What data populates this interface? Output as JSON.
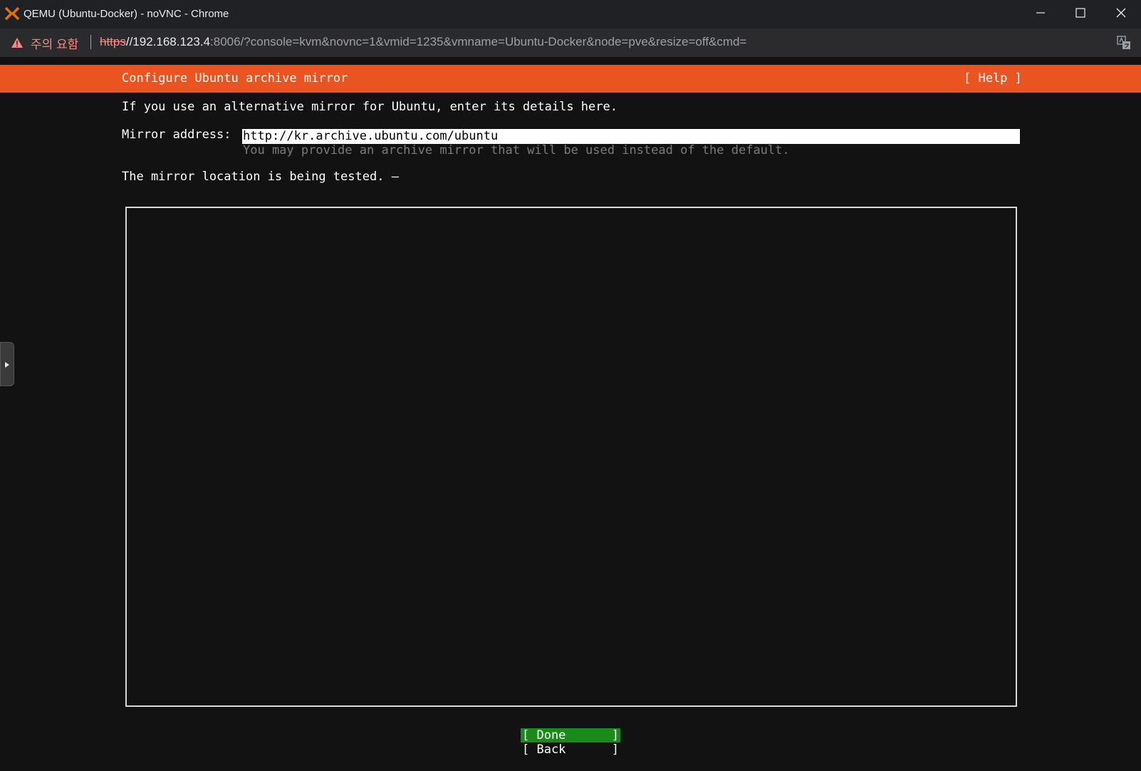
{
  "window": {
    "title": "QEMU (Ubuntu-Docker) - noVNC - Chrome",
    "app_icon": "proxmox-icon",
    "controls": [
      "minimize-icon",
      "maximize-icon",
      "close-icon"
    ]
  },
  "address_bar": {
    "security_warning": "주의 요함",
    "url_scheme": "https",
    "url_host": "//192.168.123.4",
    "url_rest": ":8006/?console=kvm&novnc=1&vmid=1235&vmname=Ubuntu-Docker&node=pve&resize=off&cmd=",
    "translate_icon": "translate-icon"
  },
  "installer": {
    "header_title": "Configure Ubuntu archive mirror",
    "help_label": "[ Help ]",
    "intro": "If you use an alternative mirror for Ubuntu, enter its details here.",
    "mirror_label": "Mirror address:",
    "mirror_value": "http://kr.archive.ubuntu.com/ubuntu",
    "mirror_hint": "You may provide an archive mirror that will be used instead of the default.",
    "status": "The mirror location is being tested. –",
    "buttons": {
      "done_open": "[ Done",
      "done_close": "]",
      "back_open": "[ Back",
      "back_close": "]"
    }
  },
  "colors": {
    "ubuntu_orange": "#e95420",
    "done_green": "#1a8a1a",
    "terminal_bg": "#121212"
  }
}
